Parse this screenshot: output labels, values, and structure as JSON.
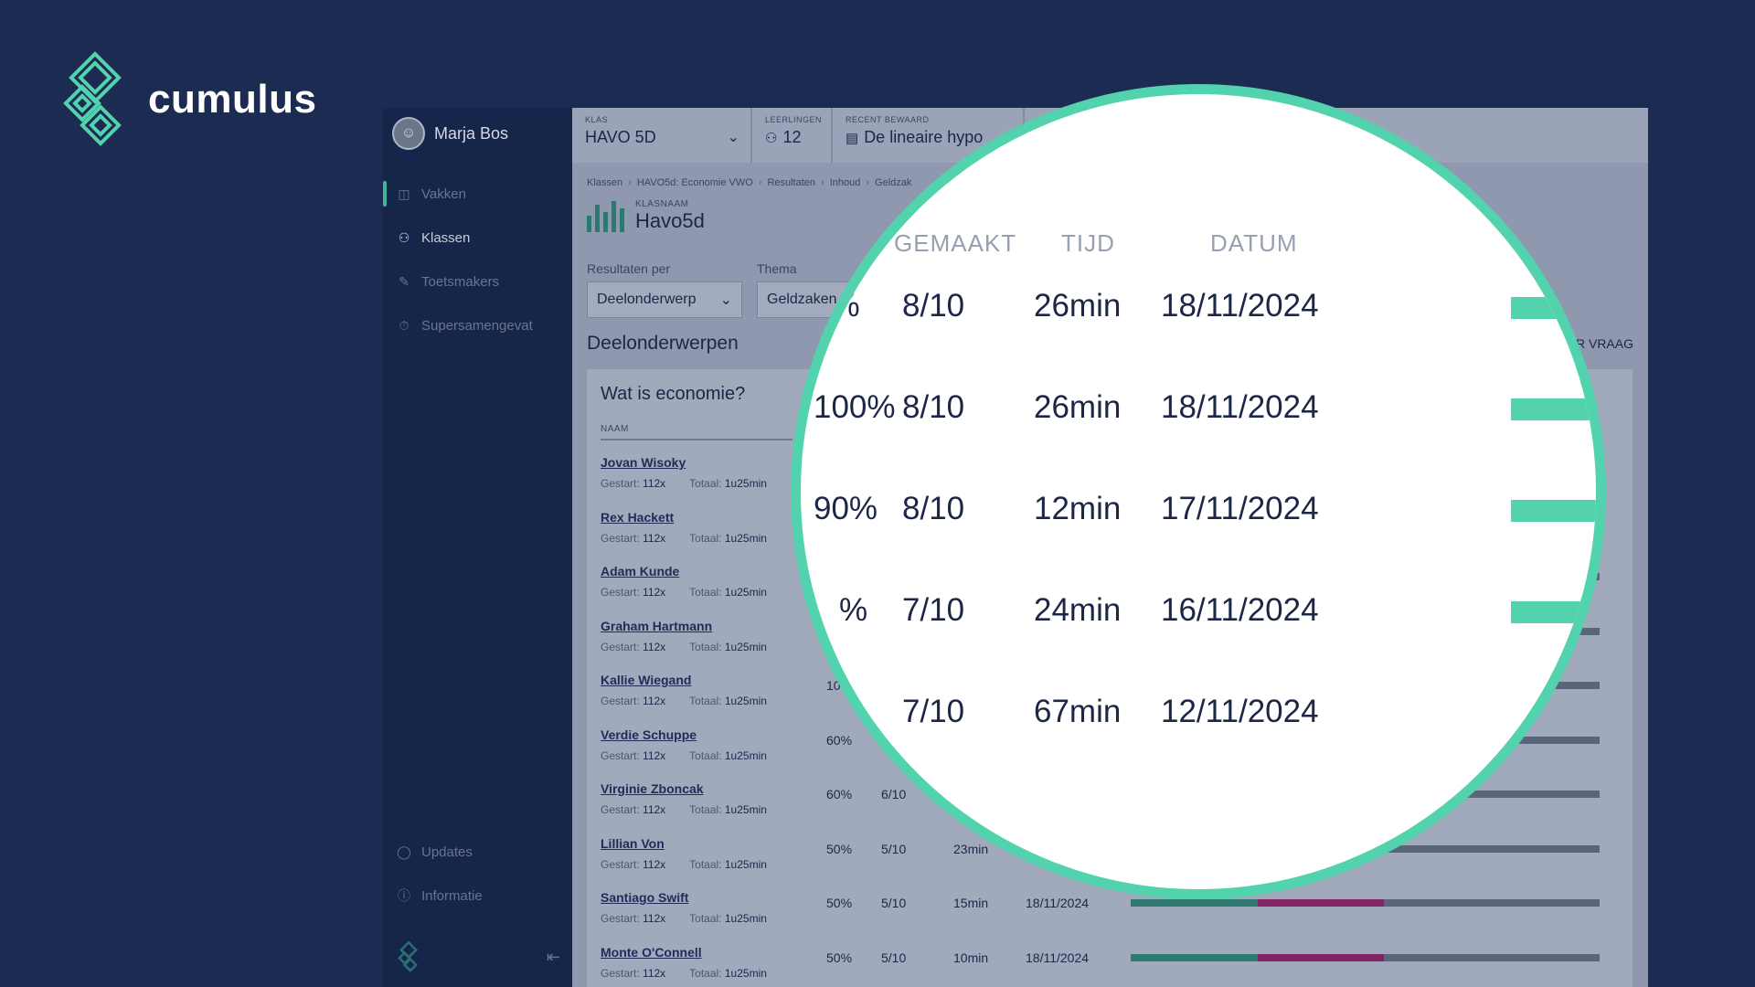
{
  "brand": {
    "name": "cumulus"
  },
  "user": {
    "name": "Marja Bos"
  },
  "sidebar": {
    "items": [
      {
        "label": "Vakken",
        "icon": "books-icon",
        "active": false
      },
      {
        "label": "Klassen",
        "icon": "people-icon",
        "active": true
      },
      {
        "label": "Toetsmakers",
        "icon": "pen-icon",
        "active": false
      },
      {
        "label": "Supersamengevat",
        "icon": "timer-icon",
        "active": false
      }
    ],
    "bottom_items": [
      {
        "label": "Updates",
        "icon": "updates-icon"
      },
      {
        "label": "Informatie",
        "icon": "info-icon"
      }
    ]
  },
  "topbar": {
    "klas_label": "KLAS",
    "klas_value": "HAVO 5D",
    "leerlingen_label": "LEERLINGEN",
    "leerlingen_value": "12",
    "recent_label": "RECENT BEWAARD",
    "recent_value": "De lineaire hypo"
  },
  "breadcrumb": [
    "Klassen",
    "HAVO5d: Economie VWO",
    "Resultaten",
    "Inhoud",
    "Geldzak"
  ],
  "class": {
    "label": "KLASNAAM",
    "name": "Havo5d"
  },
  "filters": {
    "resultaten_label": "Resultaten per",
    "resultaten_value": "Deelonderwerp",
    "thema_label": "Thema",
    "thema_value": "Geldzaken"
  },
  "section": {
    "title": "Deelonderwerpen",
    "per_vraag": "R VRAAG"
  },
  "card": {
    "title": "Wat is economie?",
    "col_naam": "NAAM",
    "meta_gestart_label": "Gestart:",
    "meta_totaal_label": "Totaal:"
  },
  "students": [
    {
      "name": "Jovan Wisoky",
      "gestart": "112x",
      "totaal": "1u25min",
      "pct": "",
      "made": "",
      "time": "",
      "date": ""
    },
    {
      "name": "Rex Hackett",
      "gestart": "112x",
      "totaal": "1u25min",
      "pct": "",
      "made": "",
      "time": "",
      "date": ""
    },
    {
      "name": "Adam Kunde",
      "gestart": "112x",
      "totaal": "1u25min",
      "pct": "",
      "made": "",
      "time": "",
      "date": ""
    },
    {
      "name": "Graham Hartmann",
      "gestart": "112x",
      "totaal": "1u25min",
      "pct": "",
      "made": "",
      "time": "",
      "date": ""
    },
    {
      "name": "Kallie Wiegand",
      "gestart": "112x",
      "totaal": "1u25min",
      "pct": "10%",
      "made": "",
      "time": "",
      "date": ""
    },
    {
      "name": "Verdie Schuppe",
      "gestart": "112x",
      "totaal": "1u25min",
      "pct": "60%",
      "made": "",
      "time": "",
      "date": ""
    },
    {
      "name": "Virginie Zboncak",
      "gestart": "112x",
      "totaal": "1u25min",
      "pct": "60%",
      "made": "6/10",
      "time": "",
      "date": ""
    },
    {
      "name": "Lillian Von",
      "gestart": "112x",
      "totaal": "1u25min",
      "pct": "50%",
      "made": "5/10",
      "time": "23min",
      "date": ""
    },
    {
      "name": "Santiago Swift",
      "gestart": "112x",
      "totaal": "1u25min",
      "pct": "50%",
      "made": "5/10",
      "time": "15min",
      "date": "18/11/2024",
      "bar": {
        "green": 0.27,
        "purple": 0.27
      }
    },
    {
      "name": "Monte O'Connell",
      "gestart": "112x",
      "totaal": "1u25min",
      "pct": "50%",
      "made": "5/10",
      "time": "10min",
      "date": "18/11/2024",
      "bar": {
        "green": 0.27,
        "purple": 0.27
      }
    }
  ],
  "magnifier": {
    "headers": {
      "gemaakt": "GEMAAKT",
      "tijd": "TIJD",
      "datum": "DATUM"
    },
    "rows": [
      {
        "pct": "0%",
        "made": "8/10",
        "time": "26min",
        "date": "18/11/2024"
      },
      {
        "pct": "100%",
        "made": "8/10",
        "time": "26min",
        "date": "18/11/2024"
      },
      {
        "pct": "90%",
        "made": "8/10",
        "time": "12min",
        "date": "17/11/2024"
      },
      {
        "pct": "%",
        "made": "7/10",
        "time": "24min",
        "date": "16/11/2024"
      },
      {
        "pct": "",
        "made": "7/10",
        "time": "67min",
        "date": "12/11/2024"
      }
    ]
  },
  "colors": {
    "accent": "#53d3ad",
    "bar_green": "#2f7b71",
    "bar_purple": "#842463"
  }
}
